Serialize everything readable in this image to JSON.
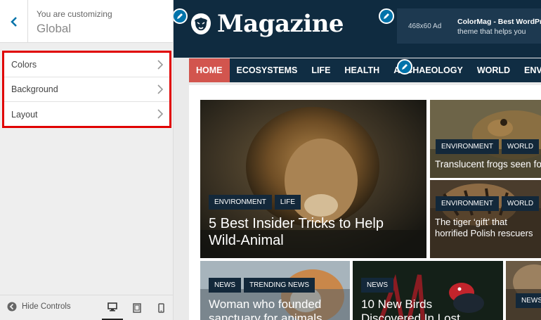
{
  "customizer": {
    "label": "You are customizing",
    "title": "Global",
    "sections": [
      {
        "label": "Colors"
      },
      {
        "label": "Background"
      },
      {
        "label": "Layout"
      }
    ],
    "footer": {
      "hide_controls": "Hide Controls"
    }
  },
  "site": {
    "title": "Magazine",
    "ad": {
      "label": "468x60 Ad",
      "name": "ColorMag - Best WordPr",
      "desc": "theme that helps you"
    },
    "nav": [
      {
        "label": "HOME"
      },
      {
        "label": "ECOSYSTEMS"
      },
      {
        "label": "LIFE"
      },
      {
        "label": "HEALTH"
      },
      {
        "label": "ARCHAEOLOGY"
      },
      {
        "label": "WORLD"
      },
      {
        "label": "ENVIRONMENT"
      }
    ],
    "posts": [
      {
        "tags": [
          "ENVIRONMENT",
          "LIFE"
        ],
        "title": "5 Best Insider Tricks to Help Wild-Animal"
      },
      {
        "tags": [
          "ENVIRONMENT",
          "WORLD"
        ],
        "title": "Translucent frogs seen fo"
      },
      {
        "tags": [
          "ENVIRONMENT",
          "WORLD"
        ],
        "title": "The tiger ‘gift’ that horrified Polish rescuers"
      },
      {
        "tags": [
          "NEWS",
          "TRENDING NEWS"
        ],
        "title": "Woman who founded sanctuary for animals"
      },
      {
        "tags": [
          "NEWS"
        ],
        "title": "10 New Birds Discovered In Lost"
      },
      {
        "tags": [
          "NEWS"
        ],
        "title": ""
      }
    ]
  },
  "colors": {
    "accent": "#0073aa",
    "highlight_border": "#e00000",
    "header_bg": "#0f2b40",
    "nav_active": "#d2554e"
  },
  "icons": {
    "back": "chevron-left-icon",
    "chevron": "chevron-right-icon",
    "hide": "arrow-left-circle-icon",
    "desktop": "desktop-icon",
    "tablet": "tablet-icon",
    "mobile": "mobile-icon",
    "edit": "pencil-icon",
    "logo": "lion-head-icon"
  }
}
